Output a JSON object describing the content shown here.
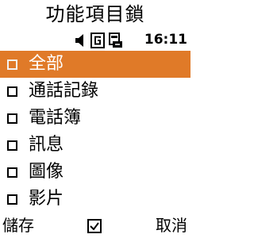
{
  "screen": {
    "title": "功能項目鎖"
  },
  "status_bar": {
    "time": "16:11",
    "icons": [
      "speaker-icon",
      "network-g-icon",
      "phone-card-icon"
    ]
  },
  "menu": {
    "items": [
      {
        "label": "全部",
        "checked": false,
        "selected": true
      },
      {
        "label": "通話記錄",
        "checked": false,
        "selected": false
      },
      {
        "label": "電話簿",
        "checked": false,
        "selected": false
      },
      {
        "label": "訊息",
        "checked": false,
        "selected": false
      },
      {
        "label": "圖像",
        "checked": false,
        "selected": false
      },
      {
        "label": "影片",
        "checked": false,
        "selected": false
      }
    ]
  },
  "softkeys": {
    "left": "儲存",
    "center_icon": "checkmark-box-icon",
    "right": "取消"
  },
  "colors": {
    "highlight": "#e07a28",
    "background": "#ffffff",
    "text": "#000000"
  }
}
